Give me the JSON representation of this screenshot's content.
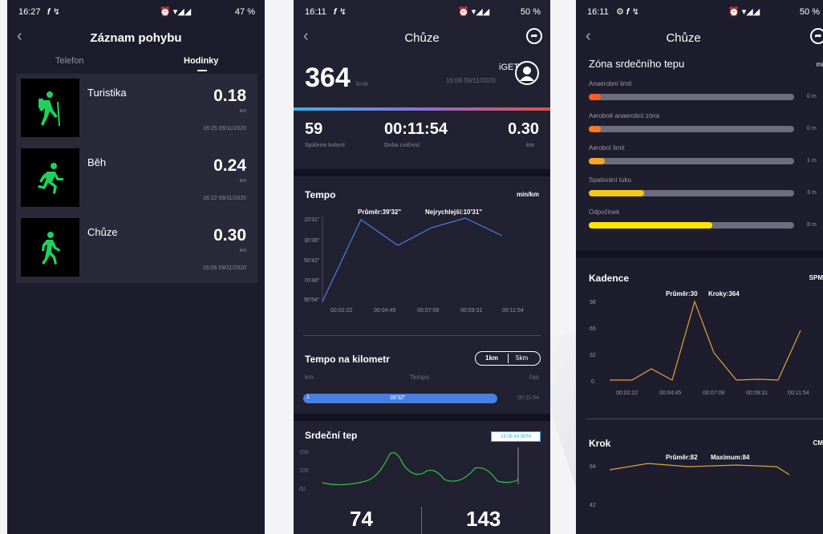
{
  "phone1": {
    "status": {
      "time": "16:27",
      "battery": "47 %"
    },
    "title": "Záznam pohybu",
    "tabs": [
      {
        "label": "Telefon"
      },
      {
        "label": "Hodinky"
      }
    ],
    "items": [
      {
        "name": "Turistika",
        "value": "0.18",
        "unit": "km",
        "date": "16:25 09/11/2020",
        "icon": "hiking-icon"
      },
      {
        "name": "Běh",
        "value": "0.24",
        "unit": "km",
        "date": "16:22 09/11/2020",
        "icon": "running-icon"
      },
      {
        "name": "Chůze",
        "value": "0.30",
        "unit": "km",
        "date": "16:06 09/11/2020",
        "icon": "walking-icon"
      }
    ],
    "accent": "#1fd15c"
  },
  "phone2": {
    "status": {
      "time": "16:11",
      "battery": "50 %"
    },
    "title": "Chůze",
    "steps": {
      "value": "364",
      "unit": "krok"
    },
    "device": {
      "name": "iGET",
      "datetime": "16:06 09/11/2020"
    },
    "stats": [
      {
        "value": "59",
        "label": "Spáleno kalorií"
      },
      {
        "value": "00:11:54",
        "label": "Doba cvičení:"
      },
      {
        "value": "0.30",
        "label": "km"
      }
    ],
    "tempo": {
      "title": "Tempo",
      "unit": "min/km",
      "avg_label": "Průměr:39'32\"",
      "fastest_label": "Nejrychlejší:10'31\"",
      "y_ticks": [
        "10'31\"",
        "30'36\"",
        "50'42\"",
        "70'48\"",
        "90'54\""
      ],
      "x_ticks": [
        "00:02:22",
        "00:04:45",
        "00:07:08",
        "00:09:31",
        "00:11:54"
      ]
    },
    "per_km": {
      "title": "Tempo na kilometr",
      "toggle": [
        "1km",
        "5km"
      ],
      "col_km": "km",
      "col_tempo": "Tempo",
      "col_time": "čas",
      "row": {
        "km": "1",
        "tempo": "39'32\"",
        "time": "00:11:54"
      }
    },
    "heart": {
      "title": "Srdeční tep",
      "tooltip": "16:06 84 BPM",
      "y_ticks": [
        "150",
        "105",
        "60"
      ],
      "bottom_values": [
        "74",
        "143"
      ]
    },
    "line_color": "#4a7fe0",
    "heart_color": "#32c83e"
  },
  "phone3": {
    "status": {
      "time": "16:11",
      "battery": "50 %"
    },
    "title": "Chůze",
    "zones": {
      "title": "Zóna srdečního tepu",
      "unit": "mi",
      "items": [
        {
          "label": "Anaerobní limit",
          "value": "0 m",
          "fill": 0.06,
          "color": "#ff5a1f"
        },
        {
          "label": "Aerobně anaerobní zóna",
          "value": "0 m",
          "fill": 0.06,
          "color": "#ff7a1f"
        },
        {
          "label": "Aerobní limit",
          "value": "1 m",
          "fill": 0.08,
          "color": "#f5a623"
        },
        {
          "label": "Spalování tuku",
          "value": "3 m",
          "fill": 0.27,
          "color": "#f5c518"
        },
        {
          "label": "Odpočinek",
          "value": "8 m",
          "fill": 0.6,
          "color": "#ffe600"
        }
      ]
    },
    "cadence": {
      "title": "Kadence",
      "unit": "SPM",
      "avg_label": "Průměr:30",
      "steps_label": "Kroky:364",
      "y_ticks": [
        "98",
        "65",
        "32",
        "0"
      ],
      "x_ticks": [
        "00:02:22",
        "00:04:45",
        "00:07:08",
        "00:09:31",
        "00:11:54"
      ]
    },
    "krok": {
      "title": "Krok",
      "unit": "CM",
      "avg_label": "Průměr:82",
      "max_label": "Maximum:84",
      "y_ticks": [
        "84",
        "42"
      ]
    },
    "line_color": "#e0a33a"
  }
}
